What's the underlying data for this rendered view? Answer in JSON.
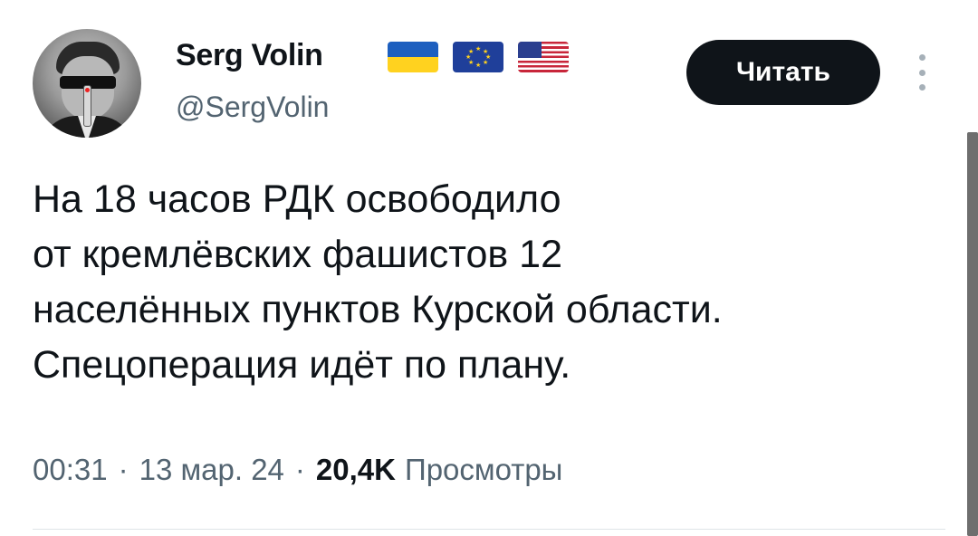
{
  "author": {
    "display_name": "Serg Volin",
    "handle": "@SergVolin",
    "flags": [
      "flag-ukraine",
      "flag-european-union",
      "flag-united-states"
    ]
  },
  "follow_button": {
    "label": "Читать"
  },
  "tweet": {
    "lines": [
      "На 18 часов РДК освободило",
      "от кремлёвских фашистов 12",
      "населённых пунктов Курской области.",
      "Спецоперация идёт по плану."
    ]
  },
  "meta": {
    "time": "00:31",
    "separator": "·",
    "date": "13 мар. 24",
    "views_count": "20,4K",
    "views_label": "Просмотры"
  },
  "colors": {
    "text": "#0f1419",
    "secondary_text": "#536471",
    "button_bg": "#0f1419",
    "button_text": "#ffffff"
  }
}
